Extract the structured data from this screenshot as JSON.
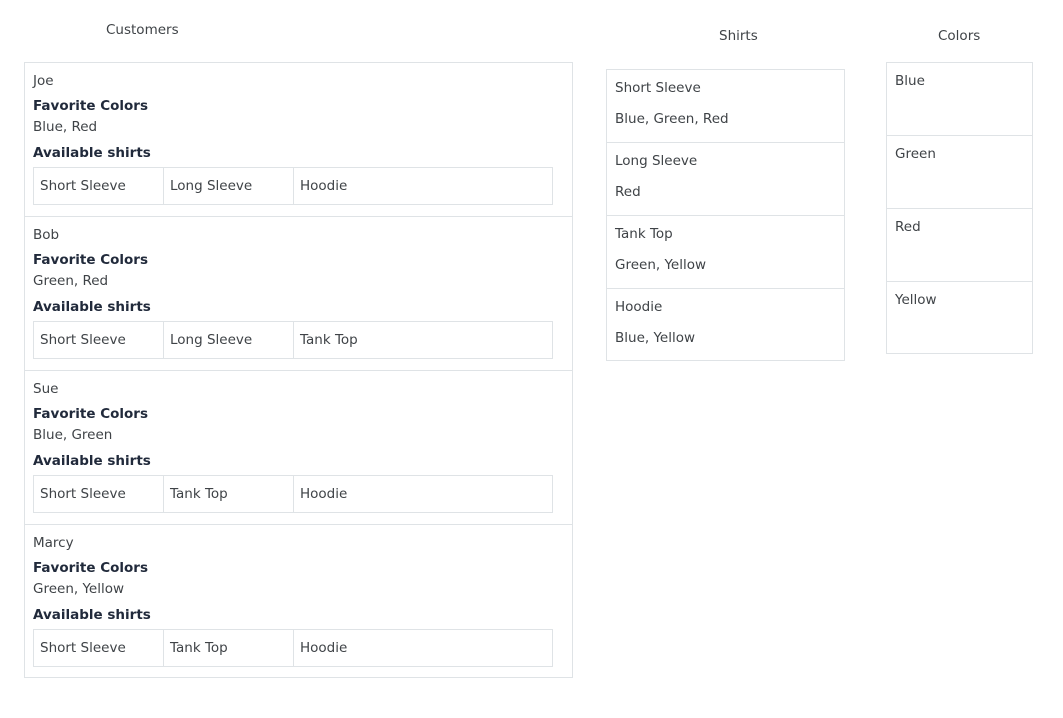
{
  "headings": {
    "customers": "Customers",
    "shirts": "Shirts",
    "colors": "Colors"
  },
  "labels": {
    "favorite_colors": "Favorite Colors",
    "available_shirts": "Available shirts"
  },
  "customers": [
    {
      "name": "Joe",
      "favorite_colors": "Blue, Red",
      "shirts": [
        "Short Sleeve",
        "Long Sleeve",
        "Hoodie"
      ]
    },
    {
      "name": "Bob",
      "favorite_colors": "Green, Red",
      "shirts": [
        "Short Sleeve",
        "Long Sleeve",
        "Tank Top"
      ]
    },
    {
      "name": "Sue",
      "favorite_colors": "Blue, Green",
      "shirts": [
        "Short Sleeve",
        "Tank Top",
        "Hoodie"
      ]
    },
    {
      "name": "Marcy",
      "favorite_colors": "Green, Yellow",
      "shirts": [
        "Short Sleeve",
        "Tank Top",
        "Hoodie"
      ]
    }
  ],
  "shirts": [
    {
      "name": "Short Sleeve",
      "colors": "Blue, Green, Red"
    },
    {
      "name": "Long Sleeve",
      "colors": "Red"
    },
    {
      "name": "Tank Top",
      "colors": "Green, Yellow"
    },
    {
      "name": "Hoodie",
      "colors": "Blue, Yellow"
    }
  ],
  "colors": [
    "Blue",
    "Green",
    "Red",
    "Yellow"
  ]
}
